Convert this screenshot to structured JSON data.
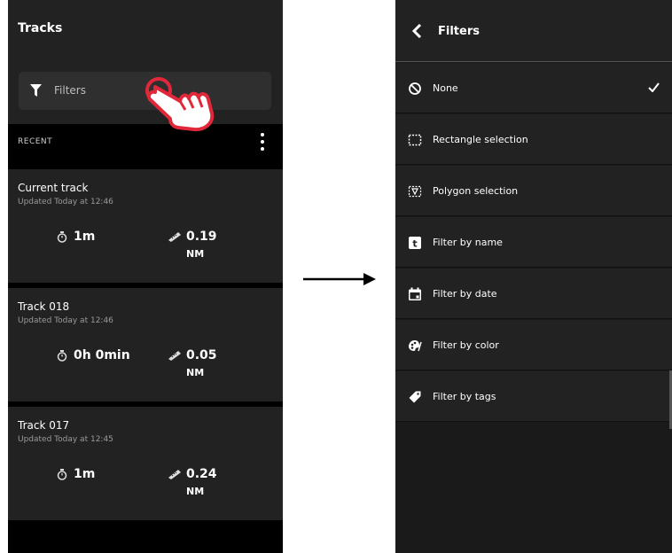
{
  "left": {
    "title": "Tracks",
    "filters_label": "Filters",
    "recent_label": "RECENT",
    "tracks": [
      {
        "name": "Current track",
        "updated": "Updated Today at 12:46",
        "duration": "1m",
        "distance": "0.19",
        "unit": "NM"
      },
      {
        "name": "Track 018",
        "updated": "Updated Today at 12:46",
        "duration": "0h 0min",
        "distance": "0.05",
        "unit": "NM"
      },
      {
        "name": "Track 017",
        "updated": "Updated Today at 12:45",
        "duration": "1m",
        "distance": "0.24",
        "unit": "NM"
      }
    ]
  },
  "right": {
    "title": "Filters",
    "items": [
      {
        "label": "None",
        "icon": "no-symbol-icon",
        "selected": true
      },
      {
        "label": "Rectangle selection",
        "icon": "rectangle-selection-icon"
      },
      {
        "label": "Polygon selection",
        "icon": "polygon-selection-icon"
      },
      {
        "label": "Filter by name",
        "icon": "text-icon"
      },
      {
        "label": "Filter by date",
        "icon": "calendar-icon"
      },
      {
        "label": "Filter by color",
        "icon": "palette-icon"
      },
      {
        "label": "Filter by tags",
        "icon": "tag-icon"
      }
    ]
  },
  "colors": {
    "accent": "#e0283a",
    "card": "#222222",
    "background": "#000000"
  }
}
